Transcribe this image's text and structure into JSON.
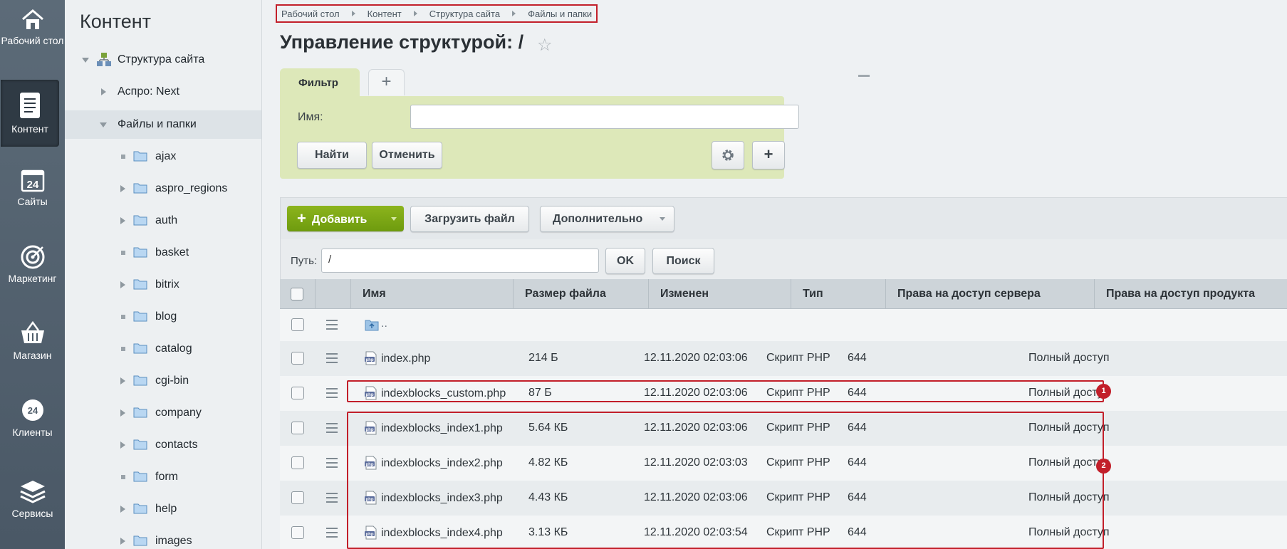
{
  "rail": {
    "items": [
      {
        "label": "Рабочий стол",
        "icon": "home-icon"
      },
      {
        "label": "Контент",
        "icon": "document-icon",
        "active": true
      },
      {
        "label": "Сайты",
        "icon": "calendar-24-icon"
      },
      {
        "label": "Маркетинг",
        "icon": "target-icon"
      },
      {
        "label": "Магазин",
        "icon": "basket-icon"
      },
      {
        "label": "Клиенты",
        "icon": "clients-24-icon"
      },
      {
        "label": "Сервисы",
        "icon": "layers-icon"
      }
    ]
  },
  "tree": {
    "title": "Контент",
    "root": "Структура сайта",
    "items": [
      {
        "label": "Аспро: Next"
      },
      {
        "label": "Файлы и папки"
      }
    ],
    "folders": [
      {
        "label": "ajax",
        "expandable": false
      },
      {
        "label": "aspro_regions",
        "expandable": true
      },
      {
        "label": "auth",
        "expandable": true
      },
      {
        "label": "basket",
        "expandable": false
      },
      {
        "label": "bitrix",
        "expandable": true
      },
      {
        "label": "blog",
        "expandable": false
      },
      {
        "label": "catalog",
        "expandable": false
      },
      {
        "label": "cgi-bin",
        "expandable": true
      },
      {
        "label": "company",
        "expandable": true
      },
      {
        "label": "contacts",
        "expandable": true
      },
      {
        "label": "form",
        "expandable": false
      },
      {
        "label": "help",
        "expandable": true
      },
      {
        "label": "images",
        "expandable": true
      }
    ]
  },
  "breadcrumb": [
    "Рабочий стол",
    "Контент",
    "Структура сайта",
    "Файлы и папки"
  ],
  "page": {
    "title": "Управление структурой: /"
  },
  "filter": {
    "tab_label": "Фильтр",
    "add_tab_label": "+",
    "name_label": "Имя:",
    "name_value": "",
    "find_label": "Найти",
    "cancel_label": "Отменить",
    "add_label": "+"
  },
  "toolbar": {
    "add_label": "Добавить",
    "upload_label": "Загрузить файл",
    "more_label": "Дополнительно"
  },
  "path": {
    "label": "Путь:",
    "value": "/",
    "ok_label": "OK",
    "search_label": "Поиск"
  },
  "table": {
    "columns": [
      "Имя",
      "Размер файла",
      "Изменен",
      "Тип",
      "Права на доступ сервера",
      "Права на доступ продукта"
    ],
    "up_label": "..",
    "rows": [
      {
        "name": "index.php",
        "size": "214 Б",
        "modified": "12.11.2020 02:03:06",
        "type": "Скрипт PHP",
        "server": "644",
        "product": "Полный доступ"
      },
      {
        "name": "indexblocks_custom.php",
        "size": "87 Б",
        "modified": "12.11.2020 02:03:06",
        "type": "Скрипт PHP",
        "server": "644",
        "product": "Полный доступ"
      },
      {
        "name": "indexblocks_index1.php",
        "size": "5.64 КБ",
        "modified": "12.11.2020 02:03:06",
        "type": "Скрипт PHP",
        "server": "644",
        "product": "Полный доступ"
      },
      {
        "name": "indexblocks_index2.php",
        "size": "4.82 КБ",
        "modified": "12.11.2020 02:03:03",
        "type": "Скрипт PHP",
        "server": "644",
        "product": "Полный доступ"
      },
      {
        "name": "indexblocks_index3.php",
        "size": "4.43 КБ",
        "modified": "12.11.2020 02:03:06",
        "type": "Скрипт PHP",
        "server": "644",
        "product": "Полный доступ"
      },
      {
        "name": "indexblocks_index4.php",
        "size": "3.13 КБ",
        "modified": "12.11.2020 02:03:54",
        "type": "Скрипт PHP",
        "server": "644",
        "product": "Полный доступ"
      }
    ]
  },
  "annotations": {
    "badge1": "1",
    "badge2": "2",
    "color": "#c21f2a"
  }
}
